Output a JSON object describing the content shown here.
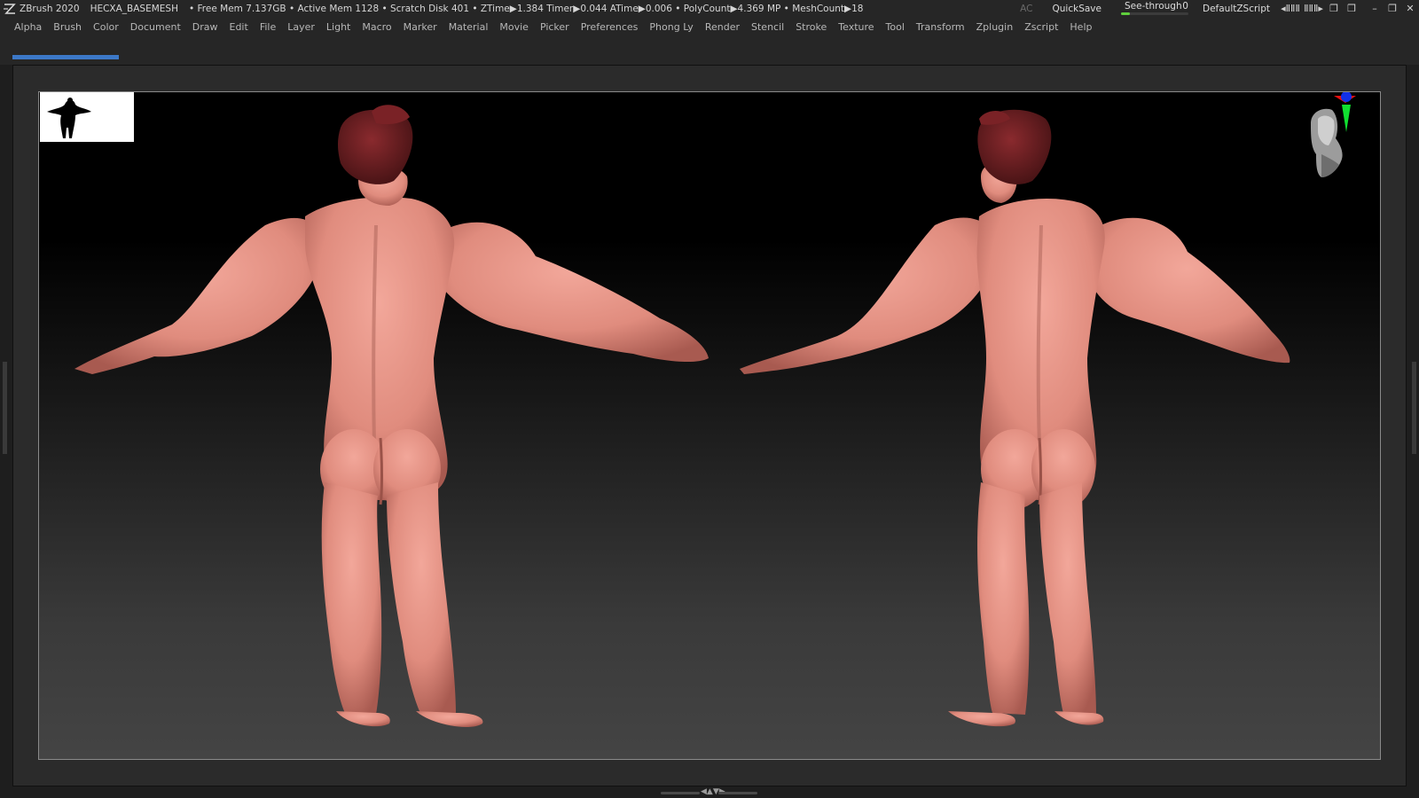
{
  "titlebar": {
    "app": "ZBrush 2020",
    "project": "HECXA_BASEMESH",
    "stats": "• Free Mem 7.137GB • Active Mem 1128 • Scratch Disk 401 •  ZTime▶1.384 Timer▶0.044 ATime▶0.006 • PolyCount▶4.369 MP  • MeshCount▶18",
    "ac": "AC",
    "quicksave": "QuickSave",
    "seethrough_label": "See-through",
    "seethrough_value": "0",
    "seethrough_level": 0.13,
    "script": "DefaultZScript",
    "buttons": [
      "◂ⅡⅡⅡ",
      "ⅡⅡⅡ▸",
      "❐",
      "❒",
      "–",
      "❐",
      "✕"
    ]
  },
  "menu": [
    "Alpha",
    "Brush",
    "Color",
    "Document",
    "Draw",
    "Edit",
    "File",
    "Layer",
    "Light",
    "Macro",
    "Marker",
    "Material",
    "Movie",
    "Picker",
    "Preferences",
    "Phong Ly",
    "Render",
    "Stencil",
    "Stroke",
    "Texture",
    "Tool",
    "Transform",
    "Zplugin",
    "Zscript",
    "Help"
  ],
  "progress": {
    "fraction": 1.0
  },
  "colors": {
    "skin": "#e89a8c",
    "skin_shadow": "#b9685d",
    "hair": "#6a1f22",
    "accent_blue": "#3c78c7",
    "seethrough_green": "#5fcf3c"
  },
  "icons": {
    "logo": "zbrush-logo-icon",
    "navcube": "head-nav-icon",
    "thumbnail": "figure-silhouette-icon"
  }
}
